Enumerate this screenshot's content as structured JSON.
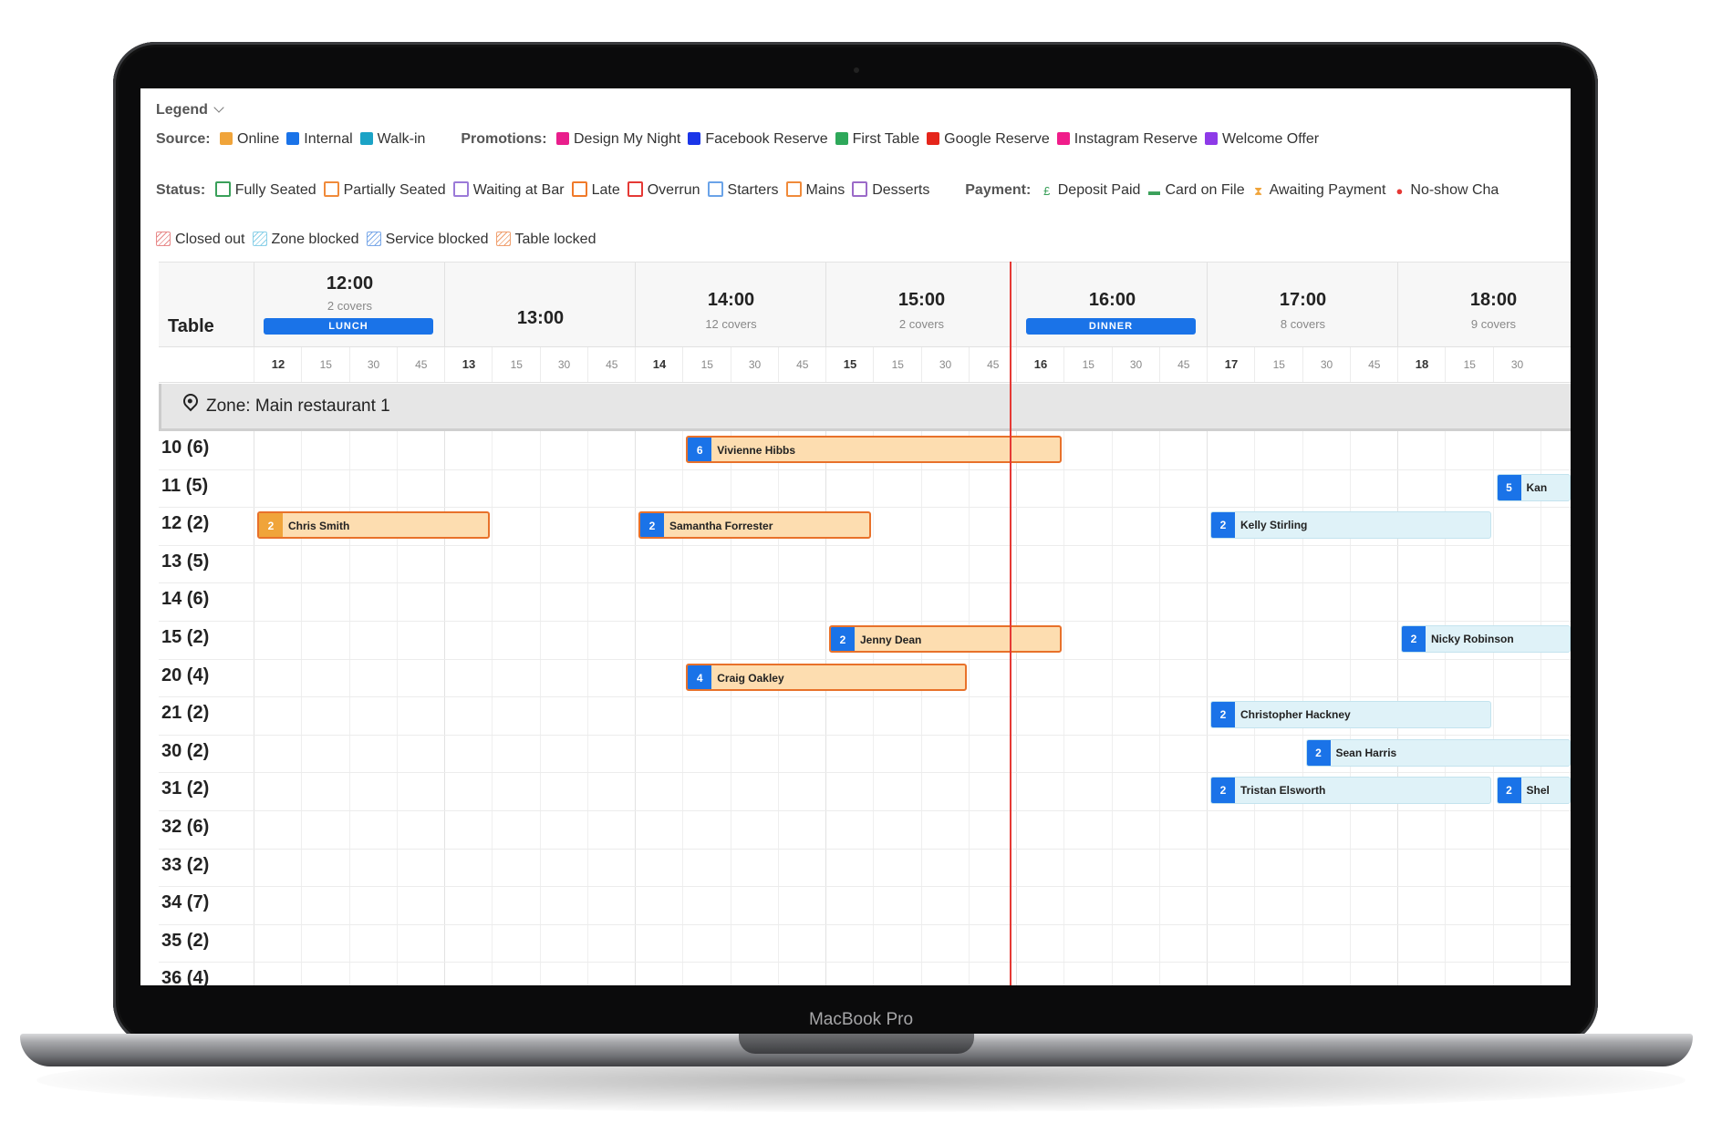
{
  "device": {
    "brand": "MacBook Pro"
  },
  "legend": {
    "title": "Legend",
    "source_label": "Source:",
    "sources": [
      {
        "label": "Online",
        "color": "#f0a43a"
      },
      {
        "label": "Internal",
        "color": "#1a73e8"
      },
      {
        "label": "Walk-in",
        "color": "#1ba3c6"
      }
    ],
    "promotions_label": "Promotions:",
    "promotions": [
      {
        "label": "Design My Night",
        "color": "#e91e8c"
      },
      {
        "label": "Facebook Reserve",
        "color": "#1a35e8"
      },
      {
        "label": "First Table",
        "color": "#2ea85a"
      },
      {
        "label": "Google Reserve",
        "color": "#e5251b"
      },
      {
        "label": "Instagram Reserve",
        "color": "#f01c8a"
      },
      {
        "label": "Welcome Offer",
        "color": "#8e3ae8"
      }
    ],
    "status_label": "Status:",
    "statuses": [
      {
        "label": "Fully Seated",
        "color": "#3aa05a"
      },
      {
        "label": "Partially Seated",
        "color": "#f08a3a"
      },
      {
        "label": "Waiting at Bar",
        "color": "#9b7ad8"
      },
      {
        "label": "Late",
        "color": "#f07a2a"
      },
      {
        "label": "Overrun",
        "color": "#e53935"
      },
      {
        "label": "Starters",
        "color": "#6aa3e8"
      },
      {
        "label": "Mains",
        "color": "#f08a3a"
      },
      {
        "label": "Desserts",
        "color": "#9b6ac8"
      }
    ],
    "payment_label": "Payment:",
    "payments": [
      {
        "label": "Deposit Paid",
        "icon": "deposit-icon",
        "color": "#3aa05a"
      },
      {
        "label": "Card on File",
        "icon": "card-icon",
        "color": "#3aa05a"
      },
      {
        "label": "Awaiting Payment",
        "icon": "hourglass-icon",
        "color": "#f0a43a"
      },
      {
        "label": "No-show Cha",
        "icon": "alert-icon",
        "color": "#e53935"
      }
    ],
    "blocks": [
      {
        "label": "Closed out",
        "color": "#e88a8a"
      },
      {
        "label": "Zone blocked",
        "color": "#8ad0e8"
      },
      {
        "label": "Service blocked",
        "color": "#7aa8e8"
      },
      {
        "label": "Table locked",
        "color": "#f0a070"
      }
    ]
  },
  "timeline": {
    "table_header": "Table",
    "hours": [
      {
        "time": "12:00",
        "covers": "2 covers",
        "service": "LUNCH"
      },
      {
        "time": "13:00",
        "covers": "",
        "service": ""
      },
      {
        "time": "14:00",
        "covers": "12 covers",
        "service": ""
      },
      {
        "time": "15:00",
        "covers": "2 covers",
        "service": ""
      },
      {
        "time": "16:00",
        "covers": "",
        "service": "DINNER"
      },
      {
        "time": "17:00",
        "covers": "8 covers",
        "service": ""
      },
      {
        "time": "18:00",
        "covers": "9 covers",
        "service": ""
      }
    ],
    "ticks": [
      "12",
      "15",
      "30",
      "45",
      "13",
      "15",
      "30",
      "45",
      "14",
      "15",
      "30",
      "45",
      "15",
      "15",
      "30",
      "45",
      "16",
      "15",
      "30",
      "45",
      "17",
      "15",
      "30",
      "45",
      "18",
      "15",
      "30"
    ],
    "zone": "Zone: Main restaurant 1",
    "tables": [
      "10 (6)",
      "11 (5)",
      "12 (2)",
      "13 (5)",
      "14 (6)",
      "15 (2)",
      "20 (4)",
      "21 (2)",
      "30 (2)",
      "31 (2)",
      "32 (6)",
      "33 (2)",
      "34 (7)",
      "35 (2)",
      "36 (4)"
    ],
    "bookings": [
      {
        "row": 0,
        "start": "14:15",
        "end": "16:15",
        "covers": "6",
        "name": "Vivienne Hibbs",
        "state": "seated"
      },
      {
        "row": 1,
        "start": "18:30",
        "end": "19:00",
        "covers": "5",
        "name": "Kan",
        "state": "upcoming"
      },
      {
        "row": 2,
        "start": "12:00",
        "end": "13:15",
        "covers": "2",
        "name": "Chris Smith",
        "state": "seated",
        "source": "online"
      },
      {
        "row": 2,
        "start": "14:00",
        "end": "15:15",
        "covers": "2",
        "name": "Samantha Forrester",
        "state": "seated"
      },
      {
        "row": 2,
        "start": "17:00",
        "end": "18:30",
        "covers": "2",
        "name": "Kelly Stirling",
        "state": "upcoming"
      },
      {
        "row": 5,
        "start": "15:00",
        "end": "16:15",
        "covers": "2",
        "name": "Jenny Dean",
        "state": "seated"
      },
      {
        "row": 5,
        "start": "18:00",
        "end": "19:00",
        "covers": "2",
        "name": "Nicky Robinson",
        "state": "upcoming"
      },
      {
        "row": 6,
        "start": "14:15",
        "end": "15:45",
        "covers": "4",
        "name": "Craig Oakley",
        "state": "seated"
      },
      {
        "row": 7,
        "start": "17:00",
        "end": "18:30",
        "covers": "2",
        "name": "Christopher Hackney",
        "state": "upcoming"
      },
      {
        "row": 8,
        "start": "17:30",
        "end": "19:00",
        "covers": "2",
        "name": "Sean Harris",
        "state": "upcoming"
      },
      {
        "row": 9,
        "start": "17:00",
        "end": "18:30",
        "covers": "2",
        "name": "Tristan Elsworth",
        "state": "upcoming"
      },
      {
        "row": 9,
        "start": "18:30",
        "end": "19:00",
        "covers": "2",
        "name": "Shel",
        "state": "upcoming"
      }
    ],
    "current_time": "15:58"
  }
}
